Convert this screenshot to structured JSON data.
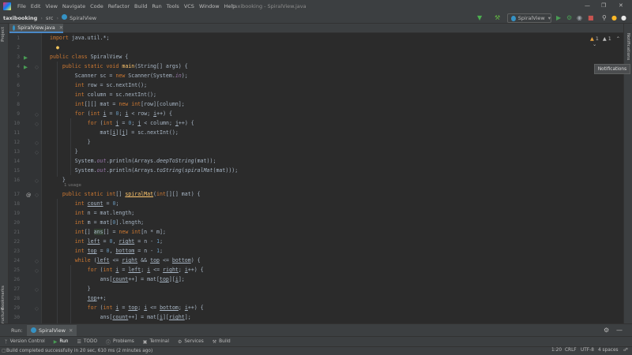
{
  "menu": [
    "File",
    "Edit",
    "View",
    "Navigate",
    "Code",
    "Refactor",
    "Build",
    "Run",
    "Tools",
    "VCS",
    "Window",
    "Help"
  ],
  "window_title": "taxibooking - SpiralView.java",
  "breadcrumbs": [
    "taxibooking",
    "src",
    "SpiralView"
  ],
  "run_config": "SpiralView",
  "left_tabs": {
    "project": "Project",
    "bookmarks": "Bookmarks",
    "structure": "Structure"
  },
  "right_tabs": {
    "notifications": "Notifications"
  },
  "tab": {
    "label": "SpiralView.java"
  },
  "inspection": {
    "warnings": "1",
    "weak": "1"
  },
  "tooltip": "Notifications",
  "usage_hint": "1 usage",
  "line_numbers": [
    "1",
    "2",
    "3",
    "4",
    "5",
    "6",
    "7",
    "8",
    "9",
    "10",
    "11",
    "12",
    "13",
    "14",
    "15",
    "16",
    "17",
    "18",
    "19",
    "20",
    "21",
    "22",
    "23",
    "24",
    "25",
    "26",
    "27",
    "28",
    "29",
    "30",
    "31"
  ],
  "run_bar": {
    "label": "Run:",
    "tab": "SpiralView"
  },
  "tool_windows": [
    "Version Control",
    "Run",
    "TODO",
    "Problems",
    "Terminal",
    "Services",
    "Build"
  ],
  "status": {
    "message": "Build completed successfully in 20 sec, 610 ms (2 minutes ago)",
    "position": "1:20",
    "line_sep": "CRLF",
    "encoding": "UTF-8",
    "indent": "4 spaces"
  }
}
